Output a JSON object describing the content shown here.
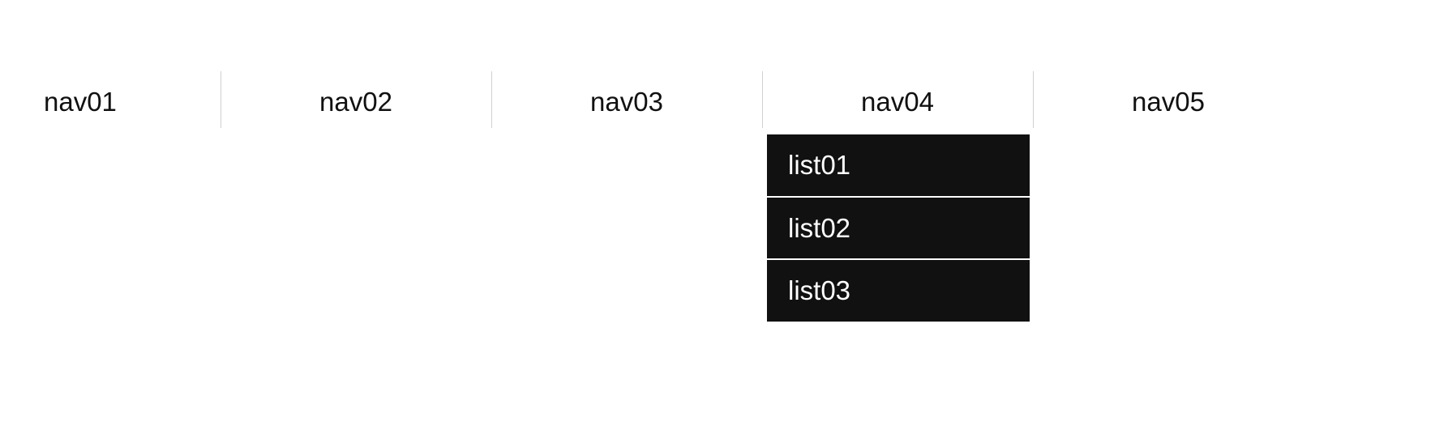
{
  "nav": {
    "items": [
      {
        "label": "nav01"
      },
      {
        "label": "nav02"
      },
      {
        "label": "nav03"
      },
      {
        "label": "nav04"
      },
      {
        "label": "nav05"
      }
    ]
  },
  "dropdown": {
    "parentIndex": 3,
    "items": [
      {
        "label": "list01"
      },
      {
        "label": "list02"
      },
      {
        "label": "list03"
      }
    ]
  }
}
